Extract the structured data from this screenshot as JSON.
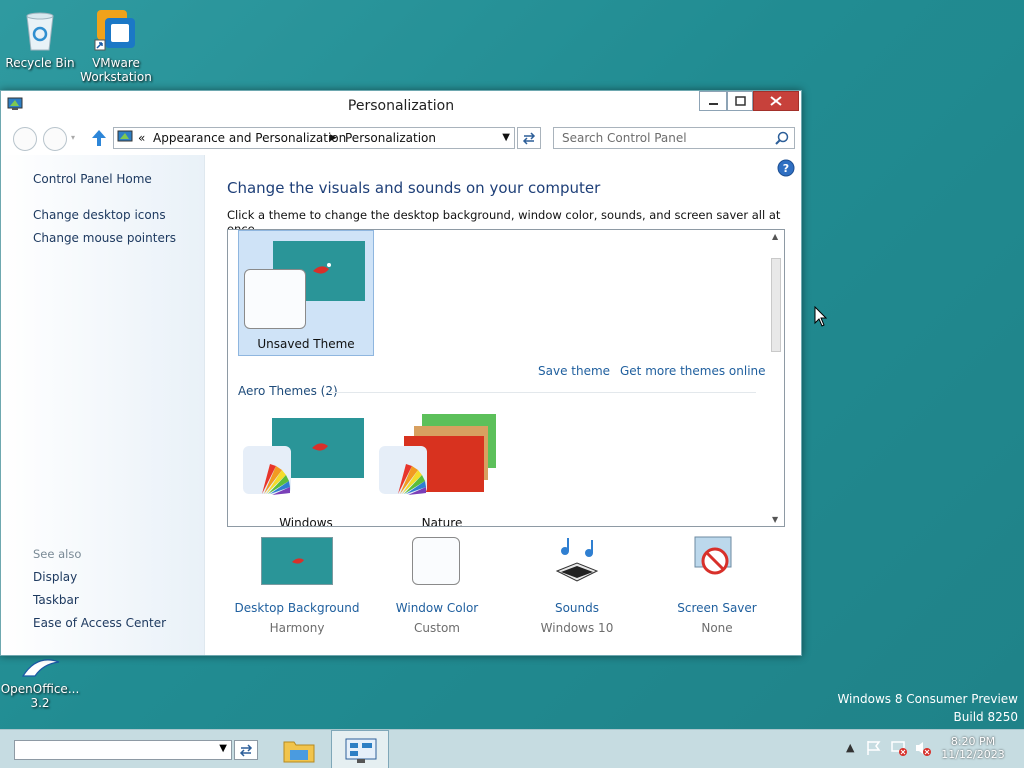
{
  "desktop": {
    "icons": [
      {
        "label": "Recycle Bin"
      },
      {
        "label": "VMware Workstation"
      },
      {
        "label": "OpenOffice... 3.2"
      }
    ],
    "watermark_line1": "Windows 8 Consumer Preview",
    "watermark_line2": "Build 8250"
  },
  "window": {
    "title": "Personalization",
    "breadcrumb": {
      "chevrons": "«",
      "items": [
        "Appearance and Personalization",
        "Personalization"
      ]
    },
    "search_placeholder": "Search Control Panel",
    "help_label": "?",
    "sidebar": {
      "links": [
        "Control Panel Home",
        "Change desktop icons",
        "Change mouse pointers"
      ],
      "see_also_label": "See also",
      "see_also": [
        "Display",
        "Taskbar",
        "Ease of Access Center"
      ]
    },
    "main": {
      "heading": "Change the visuals and sounds on your computer",
      "subtext": "Click a theme to change the desktop background, window color, sounds, and screen saver all at once.",
      "unsaved_theme": "Unsaved Theme",
      "save_theme": "Save theme",
      "get_more": "Get more themes online",
      "aero_section": "Aero Themes (2)",
      "themes": [
        "Windows",
        "Nature"
      ]
    },
    "bottom": [
      {
        "name": "Desktop Background",
        "value": "Harmony"
      },
      {
        "name": "Window Color",
        "value": "Custom"
      },
      {
        "name": "Sounds",
        "value": "Windows 10"
      },
      {
        "name": "Screen Saver",
        "value": "None"
      }
    ]
  },
  "taskbar": {
    "time": "8:20 PM",
    "date": "11/12/2023",
    "apps": [
      "file-explorer-icon",
      "control-panel-icon"
    ]
  },
  "colors": {
    "desktop": "#218c92",
    "link": "#1f5f9e",
    "heading": "#1e3f78",
    "close": "#c7413b"
  }
}
